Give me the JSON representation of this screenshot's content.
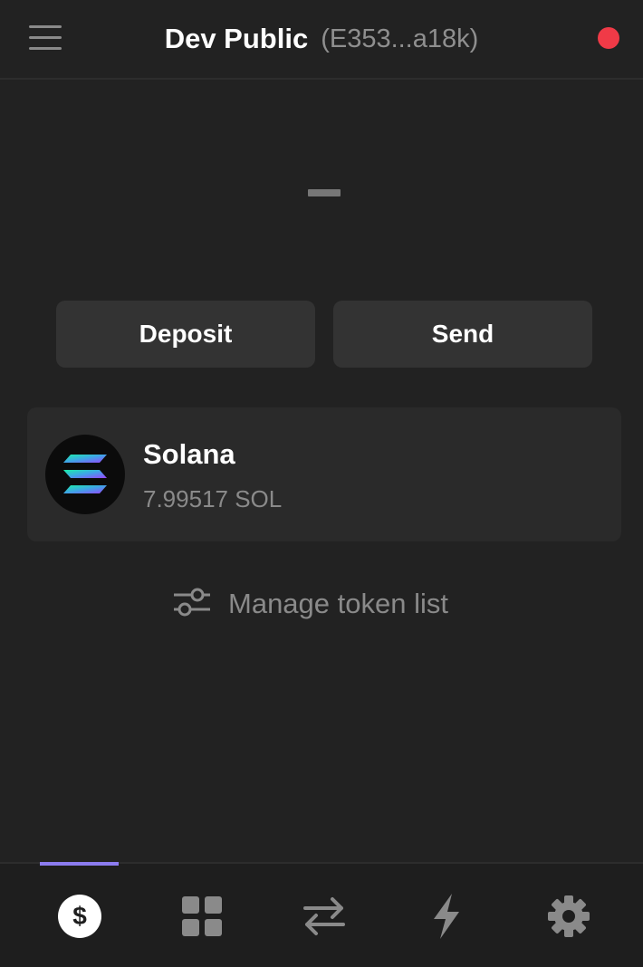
{
  "header": {
    "wallet_name": "Dev Public",
    "wallet_address": "(E353...a18k)",
    "status_color": "#f03a47"
  },
  "balance": {
    "display": "–"
  },
  "actions": {
    "deposit_label": "Deposit",
    "send_label": "Send"
  },
  "tokens": [
    {
      "name": "Solana",
      "amount": "7.99517 SOL",
      "icon": "solana-logo-icon"
    }
  ],
  "manage": {
    "label": "Manage token list",
    "icon": "sliders-icon"
  },
  "tabbar": {
    "active_tab": "balances",
    "accent_color": "#8c7cf0",
    "tabs": [
      {
        "id": "balances",
        "icon": "dollar-icon"
      },
      {
        "id": "apps",
        "icon": "grid-icon"
      },
      {
        "id": "swap",
        "icon": "swap-arrows-icon"
      },
      {
        "id": "activity",
        "icon": "lightning-icon"
      },
      {
        "id": "settings",
        "icon": "gear-icon"
      }
    ]
  }
}
